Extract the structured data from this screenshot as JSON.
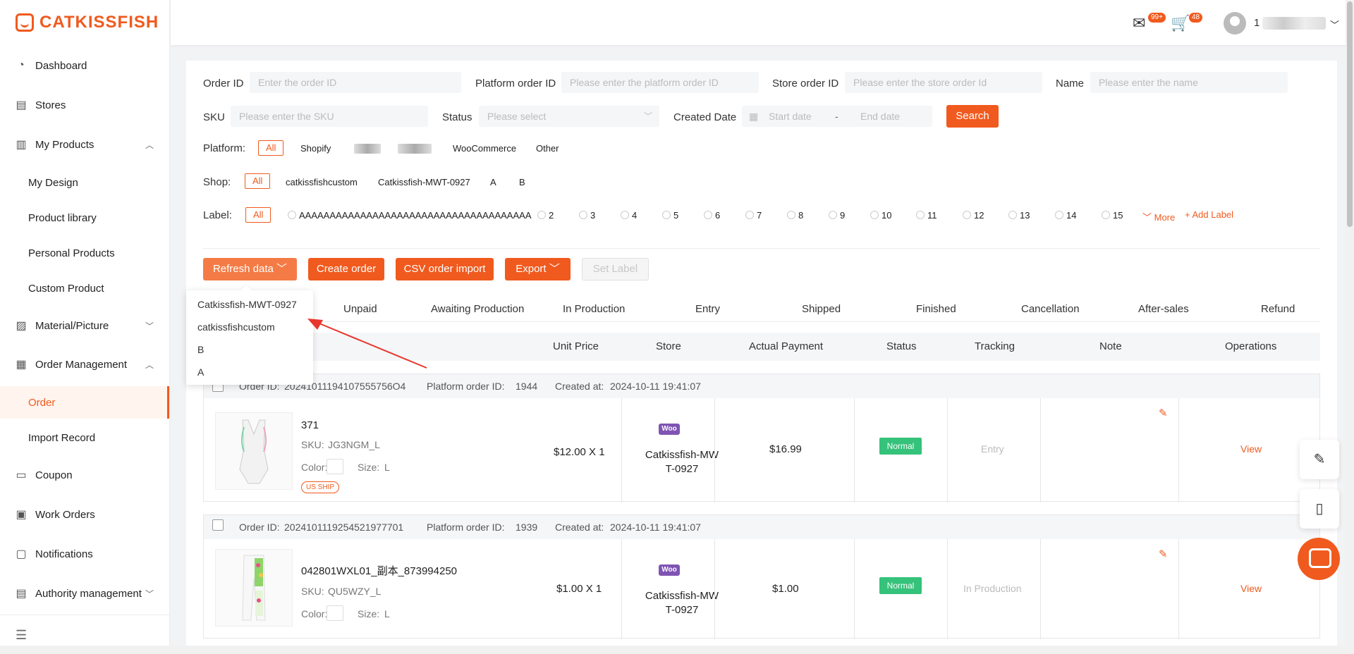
{
  "brand": "CATKISSFISH",
  "sidebar": {
    "items": [
      {
        "label": "Dashboard",
        "icon": "dashboard-icon"
      },
      {
        "label": "Stores",
        "icon": "store-icon"
      },
      {
        "label": "My Products",
        "icon": "products-icon"
      },
      {
        "label": "Material/Picture",
        "icon": "picture-icon"
      },
      {
        "label": "Order Management",
        "icon": "order-management-icon"
      },
      {
        "label": "Coupon",
        "icon": "coupon-icon"
      },
      {
        "label": "Work Orders",
        "icon": "work-orders-icon"
      },
      {
        "label": "Notifications",
        "icon": "notifications-icon"
      },
      {
        "label": "Authority management",
        "icon": "authority-icon"
      }
    ],
    "products_sub": [
      "My Design",
      "Product library",
      "Personal Products",
      "Custom Product"
    ],
    "order_sub": [
      "Order",
      "Import Record"
    ]
  },
  "header": {
    "mail_badge": "99+",
    "cart_badge": "48",
    "username_prefix": "1"
  },
  "filters": {
    "order_id_label": "Order ID",
    "order_id_placeholder": "Enter the order ID",
    "platform_order_label": "Platform order ID",
    "platform_order_placeholder": "Please enter the platform order ID",
    "store_order_label": "Store order ID",
    "store_order_placeholder": "Please enter the store order Id",
    "name_label": "Name",
    "name_placeholder": "Please enter the name",
    "sku_label": "SKU",
    "sku_placeholder": "Please enter the SKU",
    "status_label": "Status",
    "status_placeholder": "Please select",
    "created_label": "Created Date",
    "start_placeholder": "Start date",
    "date_sep": "-",
    "end_placeholder": "End date",
    "search_label": "Search",
    "platform_label": "Platform:",
    "platforms": [
      "All",
      "Shopify",
      "WooCommerce",
      "Other"
    ],
    "shop_label": "Shop:",
    "shops": [
      "All",
      "catkissfishcustom",
      "Catkissfish-MWT-0927",
      "A",
      "B"
    ],
    "label_label": "Label:",
    "labels": [
      "All",
      "AAAAAAAAAAAAAAAAAAAAAAAAAAAAAAAAAAAAAA",
      "2",
      "3",
      "4",
      "5",
      "6",
      "7",
      "8",
      "9",
      "10",
      "11",
      "12",
      "13",
      "14",
      "15"
    ],
    "more": "More",
    "add_label": "Add Label"
  },
  "actions": {
    "refresh": "Refresh data",
    "create": "Create order",
    "csv": "CSV order import",
    "export": "Export",
    "set_label": "Set Label"
  },
  "dropdown": [
    "Catkissfish-MWT-0927",
    "catkissfishcustom",
    "B",
    "A"
  ],
  "tabs": [
    "Unpaid",
    "Awaiting Production",
    "In Production",
    "Entry",
    "Shipped",
    "Finished",
    "Cancellation",
    "After-sales",
    "Refund"
  ],
  "columns": [
    "Unit Price",
    "Store",
    "Actual Payment",
    "Status",
    "Tracking",
    "Note",
    "Operations"
  ],
  "orders": [
    {
      "order_id_label": "Order ID:",
      "order_id": "20241011194107555756O4",
      "platform_label": "Platform order ID:",
      "platform_id": "1944",
      "created_label": "Created at:",
      "created": "2024-10-11 19:41:07",
      "name": "371",
      "sku_label": "SKU:",
      "sku": "JG3NGM_L",
      "color_label": "Color:",
      "size_label": "Size:",
      "size": "L",
      "ship_tag": "US SHIP",
      "price": "$12.00 X 1",
      "store": "Catkissfish-MWT-0927",
      "store_line1": "Catkissfish-MW",
      "store_line2": "T-0927",
      "payment": "$16.99",
      "status": "Normal",
      "tracking": "Entry",
      "view": "View"
    },
    {
      "order_id_label": "Order ID:",
      "order_id": "2024101119254521977701",
      "platform_label": "Platform order ID:",
      "platform_id": "1939",
      "created_label": "Created at:",
      "created": "2024-10-11 19:41:07",
      "name": "042801WXL01_副本_873994250",
      "sku_label": "SKU:",
      "sku": "QU5WZY_L",
      "color_label": "Color:",
      "size_label": "Size:",
      "size": "L",
      "price": "$1.00 X 1",
      "store_line1": "Catkissfish-MW",
      "store_line2": "T-0927",
      "payment": "$1.00",
      "status": "Normal",
      "tracking": "In Production",
      "view": "View"
    }
  ],
  "woo_badge": "Woo",
  "colors": {
    "accent": "#f05a1e",
    "status_green": "#35c27a",
    "woo_purple": "#7f54b3"
  }
}
